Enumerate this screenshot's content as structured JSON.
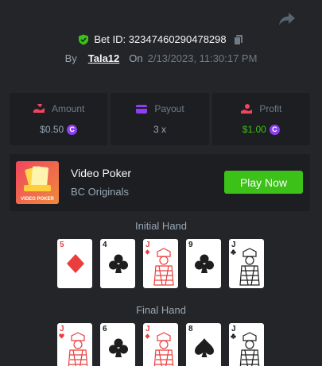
{
  "bet": {
    "id_label": "Bet ID: 32347460290478298"
  },
  "meta": {
    "by_label": "By",
    "user": "Tala12",
    "on_label": "On",
    "date": "2/13/2023, 11:30:17 PM"
  },
  "stats": {
    "amount": {
      "label": "Amount",
      "value": "$0.50"
    },
    "payout": {
      "label": "Payout",
      "value": "3 x"
    },
    "profit": {
      "label": "Profit",
      "value": "$1.00"
    }
  },
  "coin_symbol": "C",
  "game": {
    "name": "Video Poker",
    "provider": "BC Originals",
    "thumb_text": "VIDEO POKER",
    "play_label": "Play Now"
  },
  "initial_hand": {
    "title": "Initial Hand",
    "cards": [
      {
        "rank": "5",
        "suit": "diamond",
        "face": false
      },
      {
        "rank": "4",
        "suit": "club",
        "face": false
      },
      {
        "rank": "J",
        "suit": "diamond",
        "face": true
      },
      {
        "rank": "9",
        "suit": "club",
        "face": false
      },
      {
        "rank": "J",
        "suit": "club",
        "face": true
      }
    ]
  },
  "final_hand": {
    "title": "Final Hand",
    "cards": [
      {
        "rank": "J",
        "suit": "heart",
        "face": true
      },
      {
        "rank": "6",
        "suit": "club",
        "face": false
      },
      {
        "rank": "J",
        "suit": "diamond",
        "face": true
      },
      {
        "rank": "8",
        "suit": "spade",
        "face": false
      },
      {
        "rank": "J",
        "suit": "club",
        "face": true
      }
    ]
  },
  "colors": {
    "accent_green": "#3bc117",
    "coin_purple": "#8d3ff1",
    "red_suit": "#ea3e3e",
    "bg": "#232528",
    "panel": "#1c1e21"
  }
}
